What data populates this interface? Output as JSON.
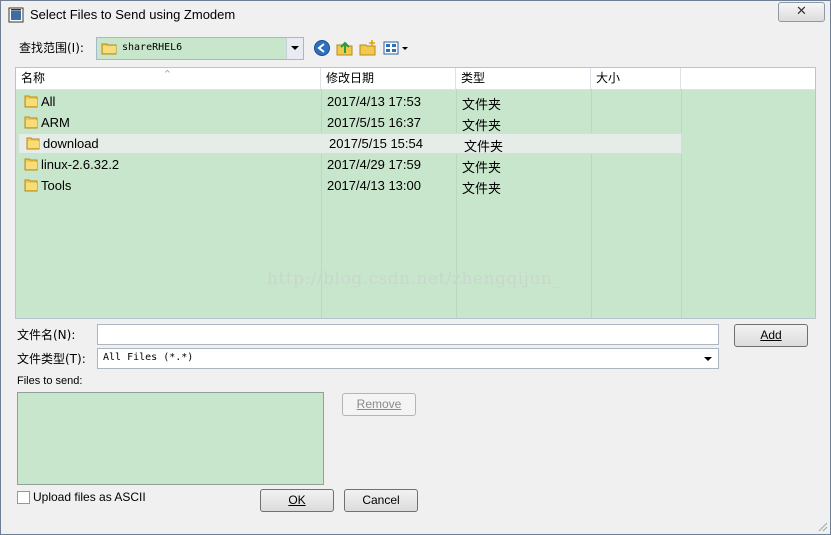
{
  "window": {
    "title": "Select Files to Send using Zmodem",
    "close_glyph": "✕"
  },
  "lookin": {
    "label": "查找范围(I):",
    "value": "shareRHEL6"
  },
  "toolbar": {
    "icons": [
      "back-icon",
      "up-folder-icon",
      "new-folder-icon",
      "view-menu-icon"
    ]
  },
  "columns": [
    "名称",
    "修改日期",
    "类型",
    "大小"
  ],
  "files": [
    {
      "name": "All",
      "modified": "2017/4/13 17:53",
      "type": "文件夹",
      "size": ""
    },
    {
      "name": "ARM",
      "modified": "2017/5/15 16:37",
      "type": "文件夹",
      "size": ""
    },
    {
      "name": "download",
      "modified": "2017/5/15 15:54",
      "type": "文件夹",
      "size": "",
      "selected": true
    },
    {
      "name": "linux-2.6.32.2",
      "modified": "2017/4/29 17:59",
      "type": "文件夹",
      "size": ""
    },
    {
      "name": "Tools",
      "modified": "2017/4/13 13:00",
      "type": "文件夹",
      "size": ""
    }
  ],
  "watermark": "http://blog.csdn.net/zhengqijun_",
  "filename": {
    "label": "文件名(N):",
    "value": ""
  },
  "filetype": {
    "label": "文件类型(T):",
    "value": "All Files (*.*)"
  },
  "buttons": {
    "add": "Add",
    "remove": "Remove",
    "ok": "OK",
    "cancel": "Cancel"
  },
  "files_to_send": {
    "label": "Files to send:"
  },
  "ascii": {
    "label": "Upload files as ASCII",
    "checked": false
  },
  "colors": {
    "list_bg": "#c8e6cb",
    "window_bg": "#f0f0f0"
  }
}
